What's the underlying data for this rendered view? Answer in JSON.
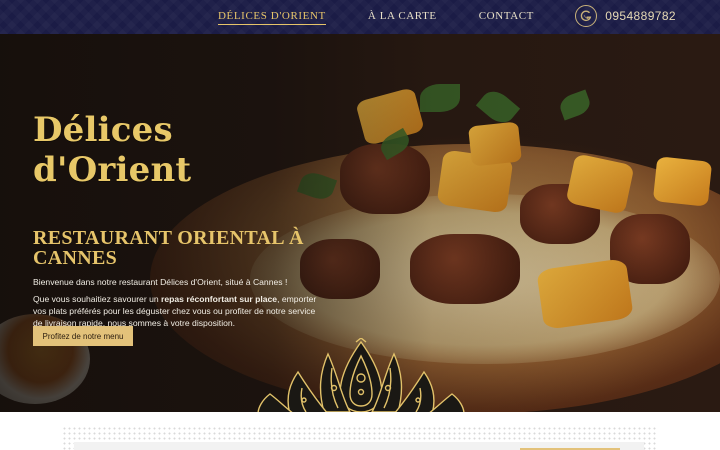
{
  "nav": {
    "items": [
      {
        "label": "DÉLICES D'ORIENT",
        "active": true
      },
      {
        "label": "À LA CARTE",
        "active": false
      },
      {
        "label": "CONTACT",
        "active": false
      }
    ],
    "phone_icon": "phone-icon",
    "phone": "0954889782"
  },
  "hero": {
    "brand": "Délices d'Orient",
    "subtitle": "RESTAURANT ORIENTAL À CANNES",
    "intro": "Bienvenue dans notre restaurant Délices d'Orient, situé à Cannes !",
    "desc_before": "Que vous souhaitiez savourer un ",
    "desc_bold": "repas réconfortant sur place",
    "desc_after": ", emporter vos plats préférés pour les déguster chez vous ou profiter de notre service de livraison rapide, nous sommes à votre disposition.",
    "cta": "Profitez de notre menu"
  },
  "colors": {
    "nav_bg": "#1b1c46",
    "gold": "#e6c46a",
    "button": "#e3c27a"
  }
}
